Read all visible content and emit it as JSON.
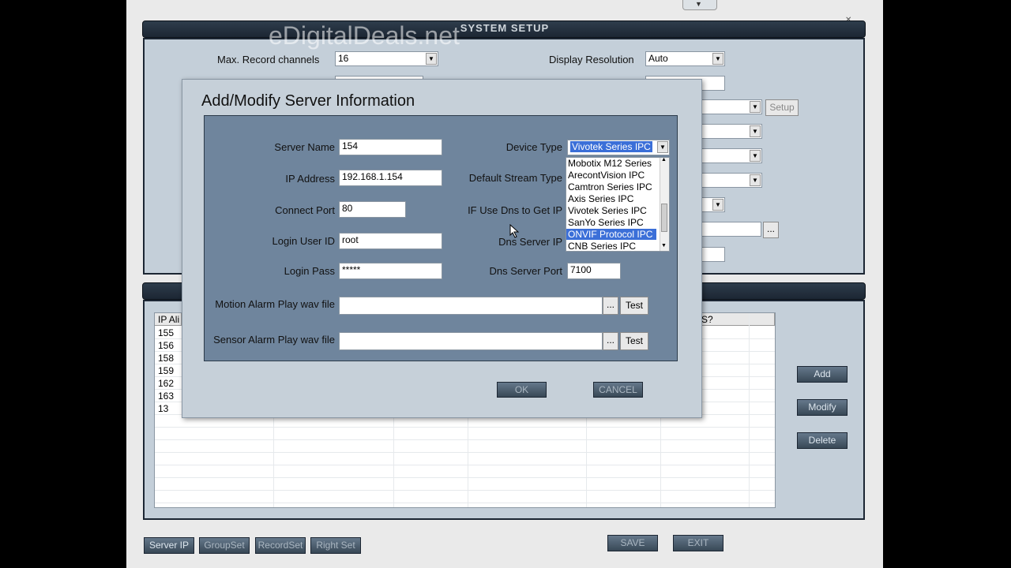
{
  "watermark": "eDigitalDeals.net",
  "window": {
    "title": "SYSTEM SETUP"
  },
  "settings": {
    "max_record_channels_label": "Max. Record channels",
    "max_record_channels_value": "16",
    "display_resolution_label": "Display  Resolution",
    "display_resolution_value": "Auto",
    "setup_button": "Setup",
    "browse_button": "..."
  },
  "server_table": {
    "columns": [
      "IP Ali",
      "S?"
    ],
    "rows": [
      "155",
      "156",
      "158",
      "159",
      "162",
      "163",
      "13"
    ]
  },
  "side_buttons": {
    "add": "Add",
    "modify": "Modify",
    "delete": "Delete"
  },
  "bottom_tabs": [
    "Server IP",
    "GroupSet",
    "RecordSet",
    "Right Set"
  ],
  "bottom_buttons": {
    "save": "SAVE",
    "exit": "EXIT"
  },
  "dialog": {
    "title": "Add/Modify Server Information",
    "server_name_label": "Server Name",
    "server_name_value": "154",
    "ip_address_label": "IP Address",
    "ip_address_value": "192.168.1.154",
    "connect_port_label": "Connect Port",
    "connect_port_value": "80",
    "login_user_label": "Login User ID",
    "login_user_value": "root",
    "login_pass_label": "Login Pass",
    "login_pass_value": "*****",
    "device_type_label": "Device Type",
    "device_type_value": "Vivotek Series IPC",
    "default_stream_label": "Default Stream Type",
    "use_dns_label": "IF Use Dns to Get IP",
    "dns_server_ip_label": "Dns Server IP",
    "dns_server_port_label": "Dns Server Port",
    "dns_server_port_value": "7100",
    "motion_alarm_label": "Motion Alarm Play wav file",
    "sensor_alarm_label": "Sensor Alarm Play wav file",
    "browse_label": "...",
    "test_label": "Test",
    "ok_label": "OK",
    "cancel_label": "CANCEL",
    "device_options": [
      "Mobotix M12 Series",
      "ArecontVision IPC",
      "Camtron Series IPC",
      "Axis Series IPC",
      "Vivotek Series IPC",
      "SanYo Series IPC",
      "ONVIF Protocol IPC",
      "CNB Series IPC"
    ],
    "device_highlighted": "ONVIF Protocol IPC"
  }
}
